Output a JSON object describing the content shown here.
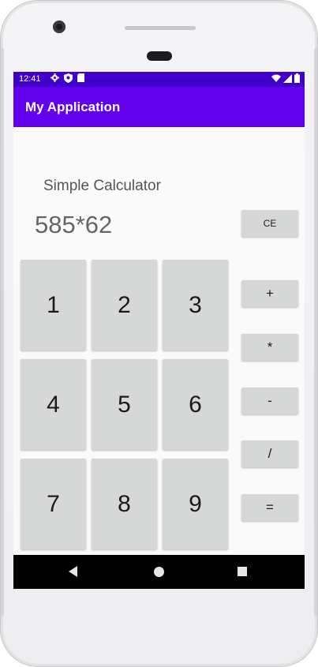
{
  "status_bar": {
    "time": "12:41",
    "icons": [
      "gear-icon",
      "shield-icon",
      "sim-card-icon"
    ],
    "right_icons": [
      "wifi-icon",
      "signal-icon",
      "battery-icon"
    ]
  },
  "app_bar": {
    "title": "My Application"
  },
  "calculator": {
    "heading": "Simple Calculator",
    "display": "585*62",
    "clear_label": "CE",
    "digits": [
      "1",
      "2",
      "3",
      "4",
      "5",
      "6",
      "7",
      "8",
      "9"
    ],
    "operators": [
      "+",
      "*",
      "-",
      "/",
      "="
    ]
  },
  "nav_bar": {
    "icons": [
      "back-icon",
      "home-icon",
      "recents-icon"
    ]
  },
  "colors": {
    "status_bar": "#3f00c9",
    "app_bar": "#6200ee",
    "button": "#d6d7d7",
    "screen_bg": "#fafafa"
  }
}
